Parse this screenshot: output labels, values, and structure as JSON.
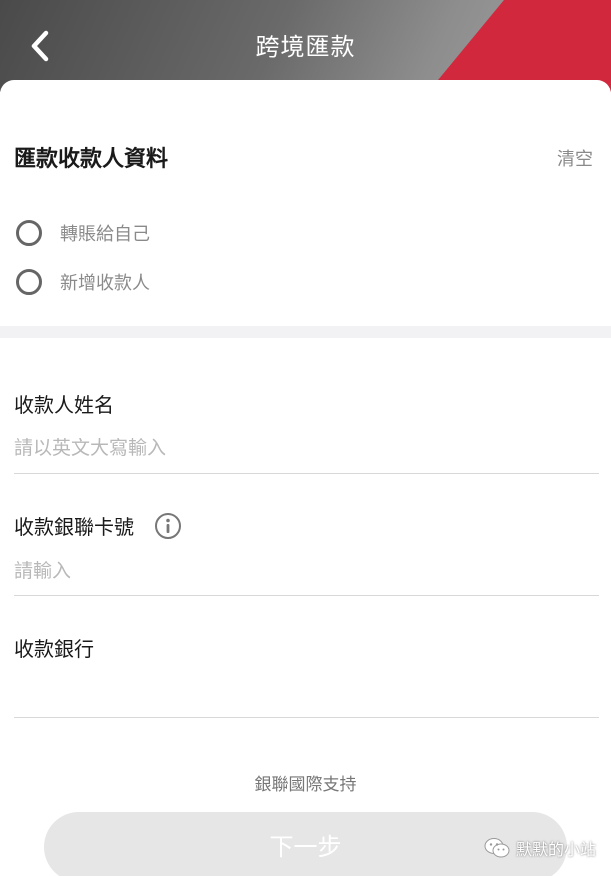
{
  "header": {
    "title": "跨境匯款"
  },
  "payee_section": {
    "title": "匯款收款人資料",
    "clear_label": "清空",
    "options": [
      {
        "label": "轉賬給自己"
      },
      {
        "label": "新增收款人"
      }
    ]
  },
  "form": {
    "name_label": "收款人姓名",
    "name_placeholder": "請以英文大寫輸入",
    "card_label": "收款銀聯卡號",
    "card_placeholder": "請輸入",
    "bank_label": "收款銀行"
  },
  "footer": {
    "support_text": "銀聯國際支持",
    "next_label": "下一步"
  },
  "watermark": {
    "text": "默默的小站"
  },
  "colors": {
    "accent_red": "#d2283e",
    "header_gray": "#5a5a5a",
    "placeholder_gray": "#b8b8b8",
    "button_disabled": "#e6e6e6"
  },
  "icons": {
    "back": "chevron-left-icon",
    "info": "info-icon",
    "wechat": "wechat-icon"
  }
}
